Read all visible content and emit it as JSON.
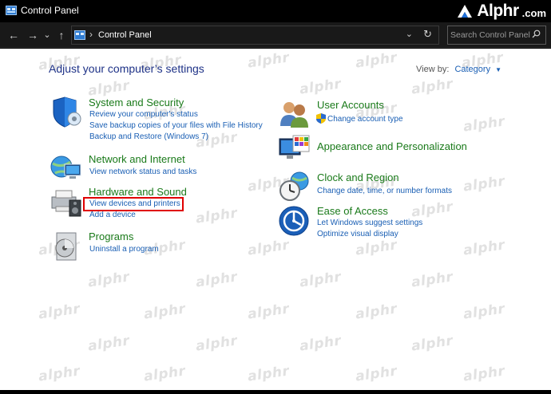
{
  "window": {
    "title": "Control Panel",
    "brand_name": "Alphr",
    "brand_tld": ".com"
  },
  "navbar": {
    "back_glyph": "←",
    "forward_glyph": "→",
    "recent_glyph": "⌄",
    "up_glyph": "↑",
    "address_separator": "›",
    "address_text": "Control Panel",
    "address_dropdown": "⌄",
    "refresh_glyph": "↻",
    "search_placeholder": "Search Control Panel"
  },
  "main": {
    "heading": "Adjust your computer’s settings",
    "view_by_label": "View by:",
    "view_by_value": "Category",
    "view_by_chevron": "▼"
  },
  "categories": [
    {
      "title": "System and Security",
      "icon": "shield-icon",
      "links": [
        "Review your computer's status",
        "Save backup copies of your files with File History",
        "Backup and Restore (Windows 7)"
      ]
    },
    {
      "title": "Network and Internet",
      "icon": "network-globe-icon",
      "links": [
        "View network status and tasks"
      ]
    },
    {
      "title": "Hardware and Sound",
      "icon": "printer-speaker-icon",
      "links": [
        "View devices and printers",
        "Add a device"
      ]
    },
    {
      "title": "Programs",
      "icon": "programs-disc-icon",
      "links": [
        "Uninstall a program"
      ]
    },
    {
      "title": "User Accounts",
      "icon": "users-icon",
      "links": [
        "Change account type"
      ]
    },
    {
      "title": "Appearance and Personalization",
      "icon": "monitor-palette-icon",
      "links": []
    },
    {
      "title": "Clock and Region",
      "icon": "clock-globe-icon",
      "links": [
        "Change date, time, or number formats"
      ]
    },
    {
      "title": "Ease of Access",
      "icon": "ease-of-access-icon",
      "links": [
        "Let Windows suggest settings",
        "Optimize visual display"
      ]
    }
  ],
  "watermark": "alphr",
  "colors": {
    "category_title": "#1a7a1a",
    "link": "#1a5fb4",
    "heading": "#1e3287",
    "highlight": "#e00000"
  }
}
